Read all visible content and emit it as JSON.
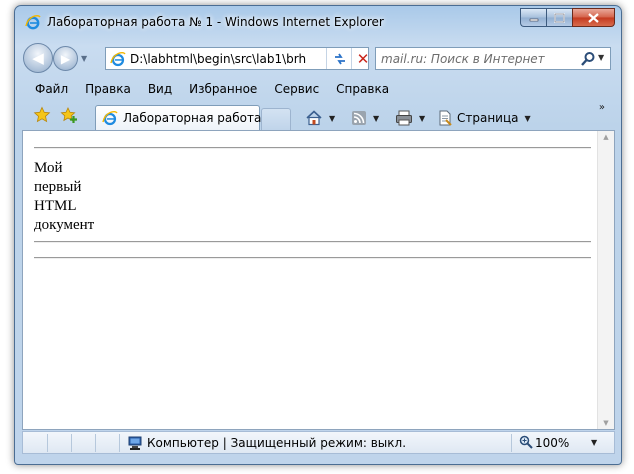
{
  "window": {
    "title": "Лабораторная работа № 1 - Windows Internet Explorer"
  },
  "address": {
    "url": "D:\\labhtml\\begin\\src\\lab1\\brh"
  },
  "search": {
    "placeholder": "mail.ru: Поиск в Интернет"
  },
  "menu": [
    "Файл",
    "Правка",
    "Вид",
    "Избранное",
    "Сервис",
    "Справка"
  ],
  "tab": {
    "label": "Лабораторная работа ..."
  },
  "toolbar": {
    "page_label": "Страница",
    "chevrons": "»"
  },
  "document": {
    "lines": [
      "Мой",
      "первый",
      "HTML",
      "документ"
    ]
  },
  "status": {
    "zone_text": "Компьютер | Защищенный режим: выкл.",
    "zoom": "100%"
  },
  "colors": {
    "frame": "#bfd4eb",
    "close_button": "#c4391f",
    "content_bg": "#ffffff"
  }
}
